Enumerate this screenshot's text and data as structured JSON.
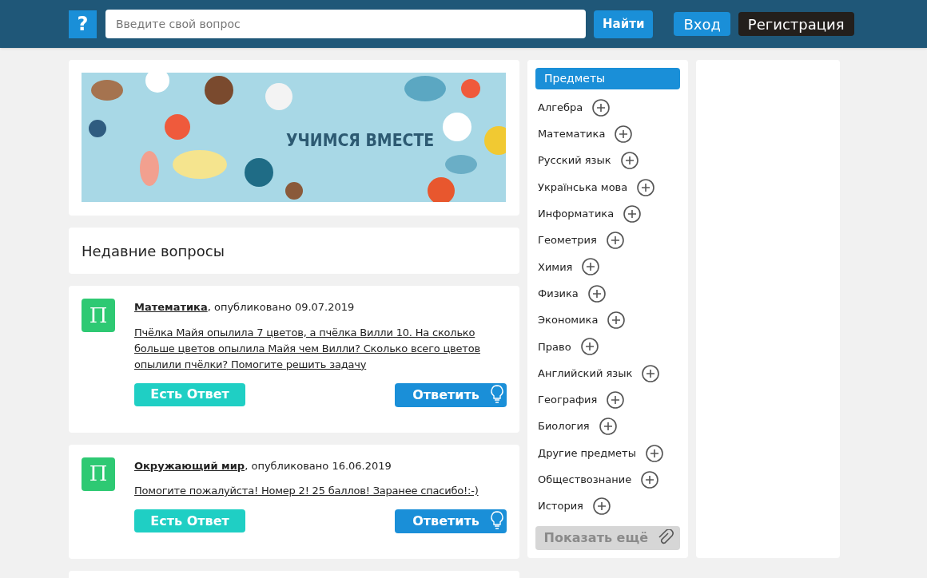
{
  "header": {
    "logo": "?",
    "search": {
      "placeholder": "Введите свой вопрос"
    },
    "search_button": "Найти",
    "login": "Вход",
    "register": "Регистрация"
  },
  "banner": {
    "text": "УЧИМСЯ ВМЕСТЕ"
  },
  "recent_title": "Недавние вопросы",
  "questions": [
    {
      "avatar": "П",
      "subject": "Математика",
      "published": ", опубликовано 09.07.2019",
      "text": "Пчёлка Майя опылила 7 цветов, а пчёлка Вилли 10. На сколько больше цветов опылила Майя чем Вилли? Сколько всего цветов опылили пчёлки? Помогите решить задачу",
      "answered_label": "Есть Ответ",
      "answer_button": "Ответить"
    },
    {
      "avatar": "П",
      "subject": "Окружающий мир",
      "published": ", опубликовано 16.06.2019",
      "text": "Помогите пожалуйста! Номер 2! 25 баллов! Заранее спасибо!:-)",
      "answered_label": "Есть Ответ",
      "answer_button": "Ответить"
    }
  ],
  "sidebar": {
    "title": "Предметы",
    "items": [
      {
        "label": "Алгебра"
      },
      {
        "label": "Математика"
      },
      {
        "label": "Русский язык"
      },
      {
        "label": "Українська мова"
      },
      {
        "label": "Информатика"
      },
      {
        "label": "Геометрия"
      },
      {
        "label": "Химия"
      },
      {
        "label": "Физика"
      },
      {
        "label": "Экономика"
      },
      {
        "label": "Право"
      },
      {
        "label": "Английский язык"
      },
      {
        "label": "География"
      },
      {
        "label": "Биология"
      },
      {
        "label": "Другие предметы"
      },
      {
        "label": "Обществознание"
      },
      {
        "label": "История"
      }
    ],
    "show_more": "Показать ещё"
  }
}
